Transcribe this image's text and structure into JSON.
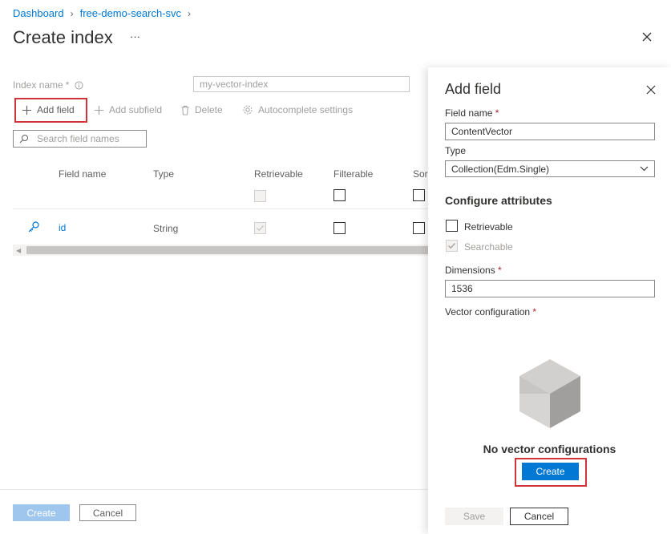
{
  "breadcrumb": {
    "items": [
      "Dashboard",
      "free-demo-search-svc"
    ]
  },
  "page": {
    "title": "Create index",
    "more_label": "···"
  },
  "form": {
    "index_name_label": "Index name",
    "index_name_req": "*",
    "index_name_value": "my-vector-index"
  },
  "toolbar": {
    "add_field": "Add field",
    "add_subfield": "Add subfield",
    "delete": "Delete",
    "autocomplete": "Autocomplete settings"
  },
  "search": {
    "placeholder": "Search field names"
  },
  "table": {
    "headers": {
      "field_name": "Field name",
      "type": "Type",
      "retrievable": "Retrievable",
      "filterable": "Filterable",
      "sortable": "Sor"
    },
    "rows": [
      {
        "name": "id",
        "type": "String",
        "icon": "key-icon"
      }
    ]
  },
  "footer": {
    "create": "Create",
    "cancel": "Cancel"
  },
  "panel": {
    "title": "Add field",
    "field_name_label": "Field name",
    "field_name_value": "ContentVector",
    "type_label": "Type",
    "type_value": "Collection(Edm.Single)",
    "attributes_title": "Configure attributes",
    "retrievable": "Retrievable",
    "searchable": "Searchable",
    "dimensions_label": "Dimensions",
    "dimensions_value": "1536",
    "vector_config_label": "Vector configuration",
    "empty_title": "No vector configurations",
    "create_button": "Create",
    "save_button": "Save",
    "cancel_button": "Cancel",
    "req": "*"
  },
  "colors": {
    "accent": "#0078d4",
    "highlight": "#d13438"
  }
}
